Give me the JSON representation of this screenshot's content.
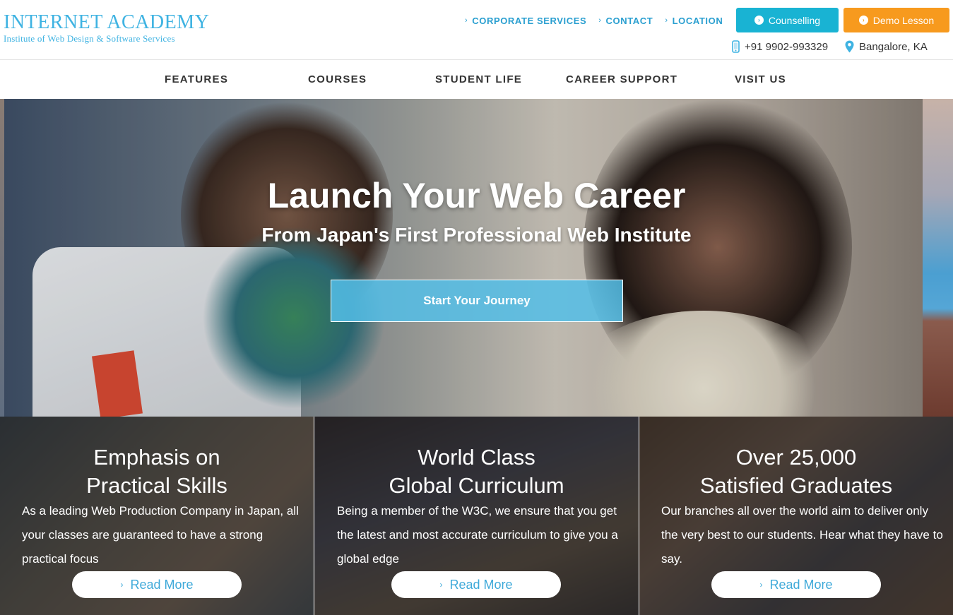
{
  "logo": {
    "title": "INTERNET ACADEMY",
    "subtitle": "Institute of Web Design & Software Services"
  },
  "top_links": [
    {
      "label": "CORPORATE SERVICES"
    },
    {
      "label": "CONTACT"
    },
    {
      "label": "LOCATION"
    }
  ],
  "buttons": {
    "counselling": "Counselling",
    "demo": "Demo Lesson"
  },
  "contact": {
    "phone": "+91 9902-993329",
    "location": "Bangalore, KA"
  },
  "nav": [
    {
      "label": "FEATURES"
    },
    {
      "label": "COURSES"
    },
    {
      "label": "STUDENT LIFE"
    },
    {
      "label": "CAREER SUPPORT"
    },
    {
      "label": "VISIT US"
    }
  ],
  "hero": {
    "title": "Launch Your Web Career",
    "subtitle": "From Japan's First Professional Web Institute",
    "cta": "Start Your Journey"
  },
  "panels": [
    {
      "title_line1": "Emphasis on",
      "title_line2": "Practical Skills",
      "text": "As a leading Web Production Company in Japan, all your classes are guaranteed to have a strong practical focus",
      "button": "Read More"
    },
    {
      "title_line1": "World Class",
      "title_line2": "Global Curriculum",
      "text": "Being a member of the W3C, we ensure that you get the latest and most accurate curriculum to give you a global edge",
      "button": "Read More"
    },
    {
      "title_line1": "Over 25,000",
      "title_line2": "Satisfied Graduates",
      "text": "Our branches all over the world aim to deliver only the very best to our students. Hear what they have to say.",
      "button": "Read More"
    }
  ],
  "colors": {
    "brand_blue": "#3fb3e2",
    "counselling_bg": "#19b3d3",
    "demo_bg": "#f79a1e",
    "cta_bg": "#54bee8"
  }
}
